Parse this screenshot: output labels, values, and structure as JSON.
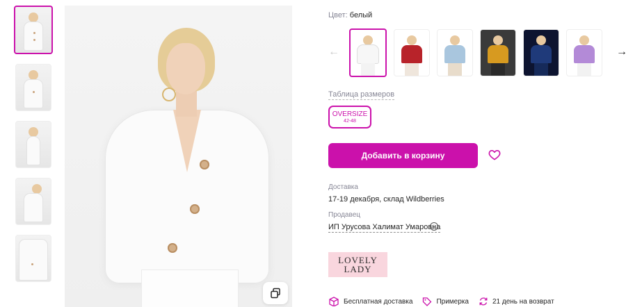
{
  "product": {
    "color_label": "Цвет:",
    "color_value": "белый",
    "size_table_label": "Таблица размеров",
    "size": {
      "name": "OVERSIZE",
      "range": "42-48"
    },
    "add_to_cart": "Добавить в корзину",
    "delivery_label": "Доставка",
    "delivery_value": "17-19 декабря, склад Wildberries",
    "seller_label": "Продавец",
    "seller_value": "ИП Урусова Халимат Умаровна",
    "brand_logo": {
      "line1": "LOVELY",
      "line2": "LADY"
    },
    "features": {
      "free_delivery": "Бесплатная доставка",
      "try_on": "Примерка",
      "return": "21 день на возврат"
    }
  },
  "colors": [
    "#f7f7f7",
    "#b8232a",
    "#a9c6de",
    "#d79a20",
    "#1f3a7a",
    "#b38ad7"
  ],
  "accent": "#cb11ab",
  "icons": [
    "copy-icon",
    "heart-icon",
    "arrow-left-icon",
    "arrow-right-icon",
    "info-icon",
    "box-icon",
    "tag-icon",
    "return-icon"
  ]
}
